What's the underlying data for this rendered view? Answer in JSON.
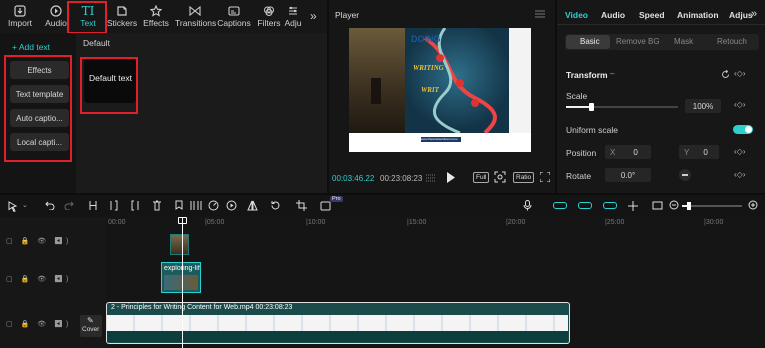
{
  "toolbar": {
    "tabs": [
      {
        "label": "Import",
        "icon": "import-icon"
      },
      {
        "label": "Audio",
        "icon": "audio-icon"
      },
      {
        "label": "Text",
        "icon": "text-icon"
      },
      {
        "label": "Stickers",
        "icon": "stickers-icon"
      },
      {
        "label": "Effects",
        "icon": "effects-icon"
      },
      {
        "label": "Transitions",
        "icon": "transitions-icon"
      },
      {
        "label": "Captions",
        "icon": "captions-icon"
      },
      {
        "label": "Filters",
        "icon": "filters-icon"
      },
      {
        "label": "Adju",
        "icon": "adjust-icon"
      }
    ],
    "more_glyph": "»"
  },
  "text_panel": {
    "add_text": "+ Add text",
    "categories": [
      "Effects",
      "Text template",
      "Auto captio...",
      "Local capti..."
    ],
    "section_title": "Default",
    "card_label": "Default text"
  },
  "player": {
    "title": "Player",
    "current_time": "00:03:46.22",
    "total_time": "00:23:08:23",
    "full_label": "Full",
    "ratio_label": "Ratio",
    "frame_heading": "DOING",
    "frame_word_1": "WRITING",
    "frame_word_2": "WRIT",
    "frame_footer": "www.thetanetsolutions.com"
  },
  "properties": {
    "tabs": [
      "Video",
      "Audio",
      "Speed",
      "Animation",
      "Adjus"
    ],
    "subtabs": [
      "Basic",
      "Remove BG",
      "Mask",
      "Retouch"
    ],
    "transform_title": "Transform",
    "scale_label": "Scale",
    "scale_value": "100%",
    "scale_level": 0.22,
    "uniform_scale_label": "Uniform scale",
    "position_label": "Position",
    "x_label": "X",
    "x_value": "0",
    "y_label": "Y",
    "y_value": "0",
    "rotate_label": "Rotate",
    "rotate_value": "0.0°",
    "accent": "#2bd1d1"
  },
  "timeline": {
    "ruler": [
      "00:00",
      "|05:00",
      "|10:00",
      "|15:00",
      "|20:00",
      "|25:00",
      "|30:00"
    ],
    "text_clip_label": "exploring-lif",
    "main_clip_label": "2 -  Principles for Writing Content for Web.mp4  00:23:08:23",
    "cover_label": "Cover",
    "pro_badge": "Pro"
  }
}
